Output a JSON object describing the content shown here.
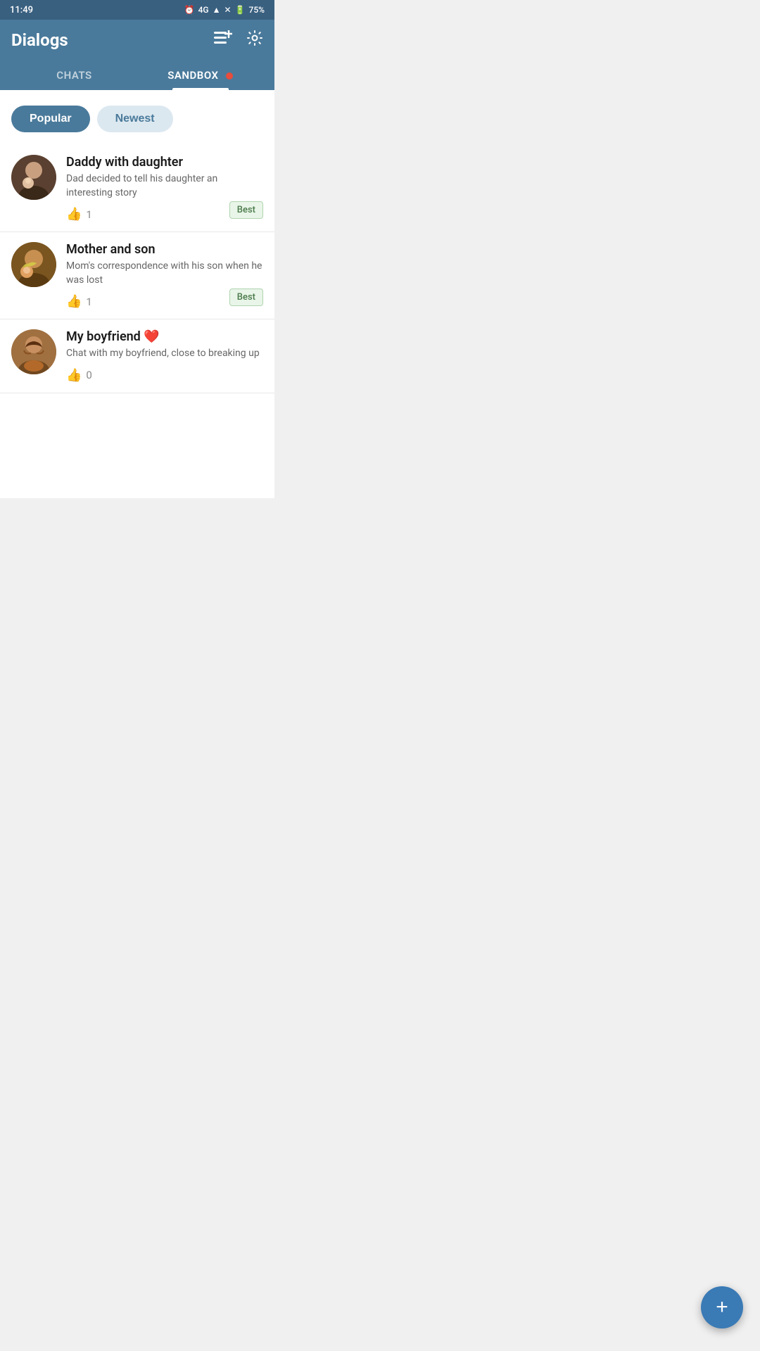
{
  "status_bar": {
    "time": "11:49",
    "signal": "4G",
    "battery": "75%"
  },
  "header": {
    "title": "Dialogs",
    "new_chat_icon": "menu-plus-icon",
    "settings_icon": "gear-icon"
  },
  "tabs": [
    {
      "id": "chats",
      "label": "CHATS",
      "active": false
    },
    {
      "id": "sandbox",
      "label": "SANDBOX",
      "active": true,
      "has_dot": true
    }
  ],
  "filters": [
    {
      "id": "popular",
      "label": "Popular",
      "active": true
    },
    {
      "id": "newest",
      "label": "Newest",
      "active": false
    }
  ],
  "chat_items": [
    {
      "id": "daddy-daughter",
      "title": "Daddy with daughter",
      "description": "Dad decided to tell his daughter an interesting story",
      "likes": 1,
      "badge": "Best",
      "avatar_type": "daddy"
    },
    {
      "id": "mother-son",
      "title": "Mother and son",
      "description": "Mom's correspondence with his son when he was lost",
      "likes": 1,
      "badge": "Best",
      "avatar_type": "mother"
    },
    {
      "id": "my-boyfriend",
      "title": "My boyfriend ❤️",
      "description": "Chat with my boyfriend, close to breaking up",
      "likes": 0,
      "badge": null,
      "avatar_type": "boyfriend"
    }
  ],
  "fab": {
    "label": "+",
    "aria": "new-chat-fab"
  }
}
